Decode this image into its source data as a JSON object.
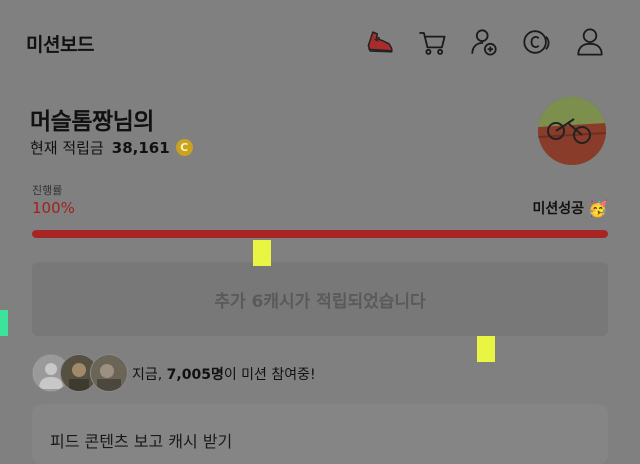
{
  "header": {
    "title": "미션보드",
    "icons": [
      "shoe-icon",
      "cart-icon",
      "add-friend-icon",
      "coin-icon",
      "profile-icon"
    ]
  },
  "user": {
    "name": "머슬톰짱님의",
    "points_label": "현재 적립금",
    "points_value": "38,161",
    "coin_symbol": "C"
  },
  "progress": {
    "label": "진행률",
    "percent_text": "100%",
    "fraction": 1.0,
    "status": "미션성공",
    "status_emoji": "🥳"
  },
  "banner": {
    "text": "추가 6캐시가 적립되었습니다"
  },
  "participants": {
    "prefix": "지금, ",
    "count": "7,005명",
    "suffix": "이 미션 참여중!"
  },
  "feed": {
    "title": "피드 콘텐츠 보고 캐시 받기"
  },
  "colors": {
    "background": "#808080",
    "progress_fill": "#a82525",
    "percent_text": "#a12020",
    "coin": "#c9a21f",
    "markers_yellow": "#e8f542",
    "marker_green": "#3de39a"
  }
}
